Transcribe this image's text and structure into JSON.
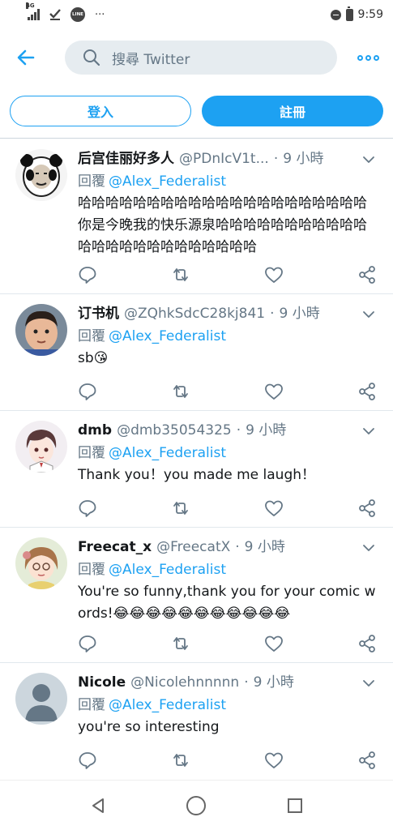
{
  "status": {
    "time": "9:59",
    "network": "4G",
    "app_badge": "LINE",
    "more": "···"
  },
  "search": {
    "placeholder": "搜尋 Twitter"
  },
  "auth": {
    "login": "登入",
    "signup": "註冊"
  },
  "colors": {
    "accent": "#1da1f2",
    "muted": "#657786",
    "text": "#14171a",
    "search_bg": "#e6ecf0"
  },
  "tweets": [
    {
      "name": "后宫佳丽好多人",
      "handle": "@PDnIcV1t...",
      "dot": "·",
      "time": "9 小時",
      "reply_label": "回覆",
      "mention": "@Alex_Federalist",
      "text": "哈哈哈哈哈哈哈哈哈哈哈哈哈哈哈哈哈哈哈哈哈你是今晚我的快乐源泉哈哈哈哈哈哈哈哈哈哈哈哈哈哈哈哈哈哈哈哈哈哈哈哈",
      "avatar": "panda-meme-avatar"
    },
    {
      "name": "订书机",
      "handle": "@ZQhkSdcC28kj841",
      "dot": "·",
      "time": "9 小時",
      "reply_label": "回覆",
      "mention": "@Alex_Federalist",
      "text": "sb😘",
      "avatar": "child-photo-avatar"
    },
    {
      "name": "dmb",
      "handle": "@dmb35054325",
      "dot": "·",
      "time": "9 小時",
      "reply_label": "回覆",
      "mention": "@Alex_Federalist",
      "text": "Thank you！you made me laugh！",
      "avatar": "anime-boy-avatar"
    },
    {
      "name": "Freecat_x",
      "handle": "@FreecatX",
      "dot": "·",
      "time": "9 小時",
      "reply_label": "回覆",
      "mention": "@Alex_Federalist",
      "text": "You're so funny,thank you for your comic words!😂😂😂😂😂😂😂😂😂😂😂",
      "avatar": "anime-girl-avatar"
    },
    {
      "name": "Nicole",
      "handle": "@Nicolehnnnnn",
      "dot": "·",
      "time": "9 小時",
      "reply_label": "回覆",
      "mention": "@Alex_Federalist",
      "text": "you're so interesting",
      "avatar": "default-avatar"
    }
  ]
}
